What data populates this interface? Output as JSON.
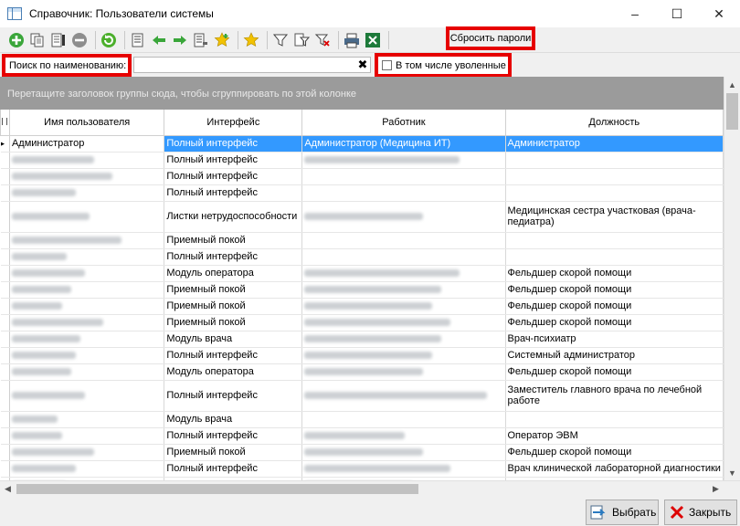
{
  "window": {
    "title": "Справочник: Пользователи системы",
    "minimize": "–",
    "maximize": "☐",
    "close": "✕"
  },
  "toolbar": {
    "reset_passwords_label": "Сбросить пароли"
  },
  "search": {
    "label": "Поиск по наименованию:",
    "value": "",
    "clear": "✖",
    "include_fired_label": "В том числе уволенные",
    "include_fired_checked": false
  },
  "group_panel": {
    "hint": "Перетащите заголовок группы сюда, чтобы сгруппировать по этой колонке"
  },
  "grid": {
    "columns": [
      "Имя пользователя",
      "Интерфейс",
      "Работник",
      "Должность"
    ],
    "rows": [
      {
        "user": "Администратор",
        "interface": "Полный интерфейс",
        "worker": "Администратор (Медицина ИТ)",
        "position": "Администратор",
        "selected": true
      },
      {
        "user": "",
        "interface": "Полный интерфейс",
        "worker": "",
        "position": ""
      },
      {
        "user": "",
        "interface": "Полный интерфейс",
        "worker": "",
        "position": ""
      },
      {
        "user": "",
        "interface": "Полный интерфейс",
        "worker": "",
        "position": ""
      },
      {
        "user": "",
        "interface": "Листки нетрудоспособности",
        "worker": "",
        "position": "Медицинская сестра участковая (врача-педиатра)",
        "tall": true
      },
      {
        "user": "",
        "interface": "Приемный покой",
        "worker": "",
        "position": ""
      },
      {
        "user": "",
        "interface": "Полный интерфейс",
        "worker": "",
        "position": ""
      },
      {
        "user": "",
        "interface": "Модуль оператора",
        "worker": "",
        "position": "Фельдшер скорой помощи"
      },
      {
        "user": "",
        "interface": "Приемный покой",
        "worker": "",
        "position": "Фельдшер скорой помощи"
      },
      {
        "user": "",
        "interface": "Приемный покой",
        "worker": "",
        "position": "Фельдшер скорой помощи"
      },
      {
        "user": "",
        "interface": "Приемный покой",
        "worker": "",
        "position": "Фельдшер скорой помощи"
      },
      {
        "user": "",
        "interface": "Модуль врача",
        "worker": "",
        "position": "Врач-психиатр"
      },
      {
        "user": "",
        "interface": "Полный интерфейс",
        "worker": "",
        "position": "Системный администратор"
      },
      {
        "user": "",
        "interface": "Модуль оператора",
        "worker": "",
        "position": "Фельдшер скорой помощи"
      },
      {
        "user": "",
        "interface": "Полный интерфейс",
        "worker": "",
        "position": "Заместитель главного врача по лечебной работе",
        "tall": true
      },
      {
        "user": "",
        "interface": "Модуль врача",
        "worker": "",
        "position": ""
      },
      {
        "user": "",
        "interface": "Полный интерфейс",
        "worker": "",
        "position": "Оператор ЭВМ"
      },
      {
        "user": "",
        "interface": "Приемный покой",
        "worker": "",
        "position": "Фельдшер скорой помощи"
      },
      {
        "user": "",
        "interface": "Полный интерфейс",
        "worker": "",
        "position": "Врач клинической лабораторной диагностики"
      },
      {
        "user": "",
        "interface": "",
        "worker": "",
        "position": ""
      }
    ]
  },
  "footer": {
    "select_label": "Выбрать",
    "close_label": "Закрыть"
  },
  "colors": {
    "selection": "#3399ff",
    "highlight": "#e60000",
    "group_panel": "#9b9b9b"
  }
}
